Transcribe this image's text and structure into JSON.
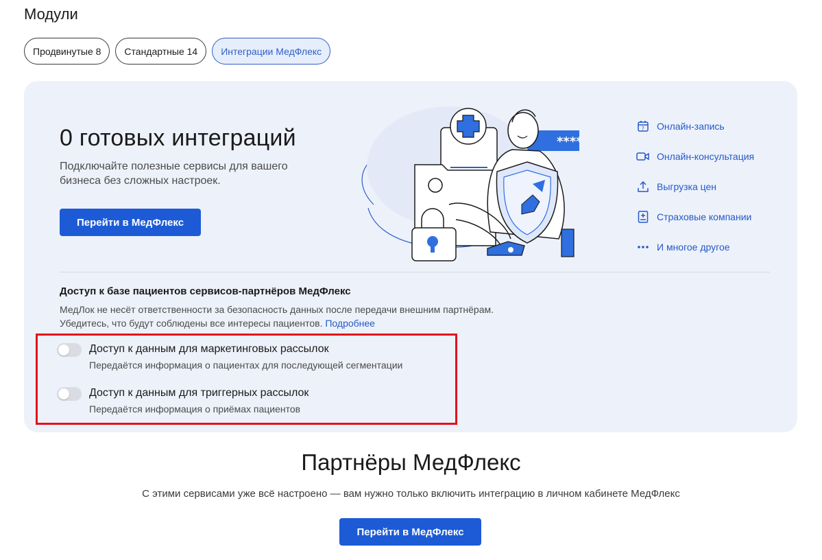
{
  "page_title": "Модули",
  "tabs": [
    {
      "label": "Продвинутые 8",
      "active": false
    },
    {
      "label": "Стандартные 14",
      "active": false
    },
    {
      "label": "Интеграции МедФлекс",
      "active": true
    }
  ],
  "hero": {
    "title": "0 готовых интеграций",
    "description": "Подключайте полезные сервисы для вашего бизнеса без сложных настроек.",
    "button_label": "Перейти в МедФлекс",
    "password_mask": "****"
  },
  "features": [
    {
      "label": "Онлайн-запись",
      "icon": "calendar-icon"
    },
    {
      "label": "Онлайн-консультация",
      "icon": "video-camera-icon"
    },
    {
      "label": "Выгрузка цен",
      "icon": "upload-icon"
    },
    {
      "label": "Страховые компании",
      "icon": "document-plus-icon"
    },
    {
      "label": "И многое другое",
      "icon": "more-dots-icon"
    }
  ],
  "access": {
    "title": "Доступ к базе пациентов сервисов-партнёров МедФлекс",
    "description_line1": "МедЛок не несёт ответственности за безопасность данных после передачи внешним партнёрам.",
    "description_line2": "Убедитесь, что будут соблюдены все интересы пациентов.",
    "link_label": "Подробнее",
    "toggles": [
      {
        "label": "Доступ к данным для маркетинговых рассылок",
        "sublabel": "Передаётся информация о пациентах для последующей сегментации",
        "enabled": false
      },
      {
        "label": "Доступ к данным для триггерных рассылок",
        "sublabel": "Передаётся информация о приёмах пациентов",
        "enabled": false
      }
    ]
  },
  "partners": {
    "title": "Партнёры МедФлекс",
    "description": "С этими сервисами уже всё настроено — вам нужно только включить интеграцию в личном кабинете МедФлекс",
    "button_label": "Перейти в МедФлекс"
  },
  "colors": {
    "accent": "#1d5bd6",
    "link": "#2459c9",
    "card_bg": "#edf1fa",
    "highlight": "#e0121e"
  }
}
